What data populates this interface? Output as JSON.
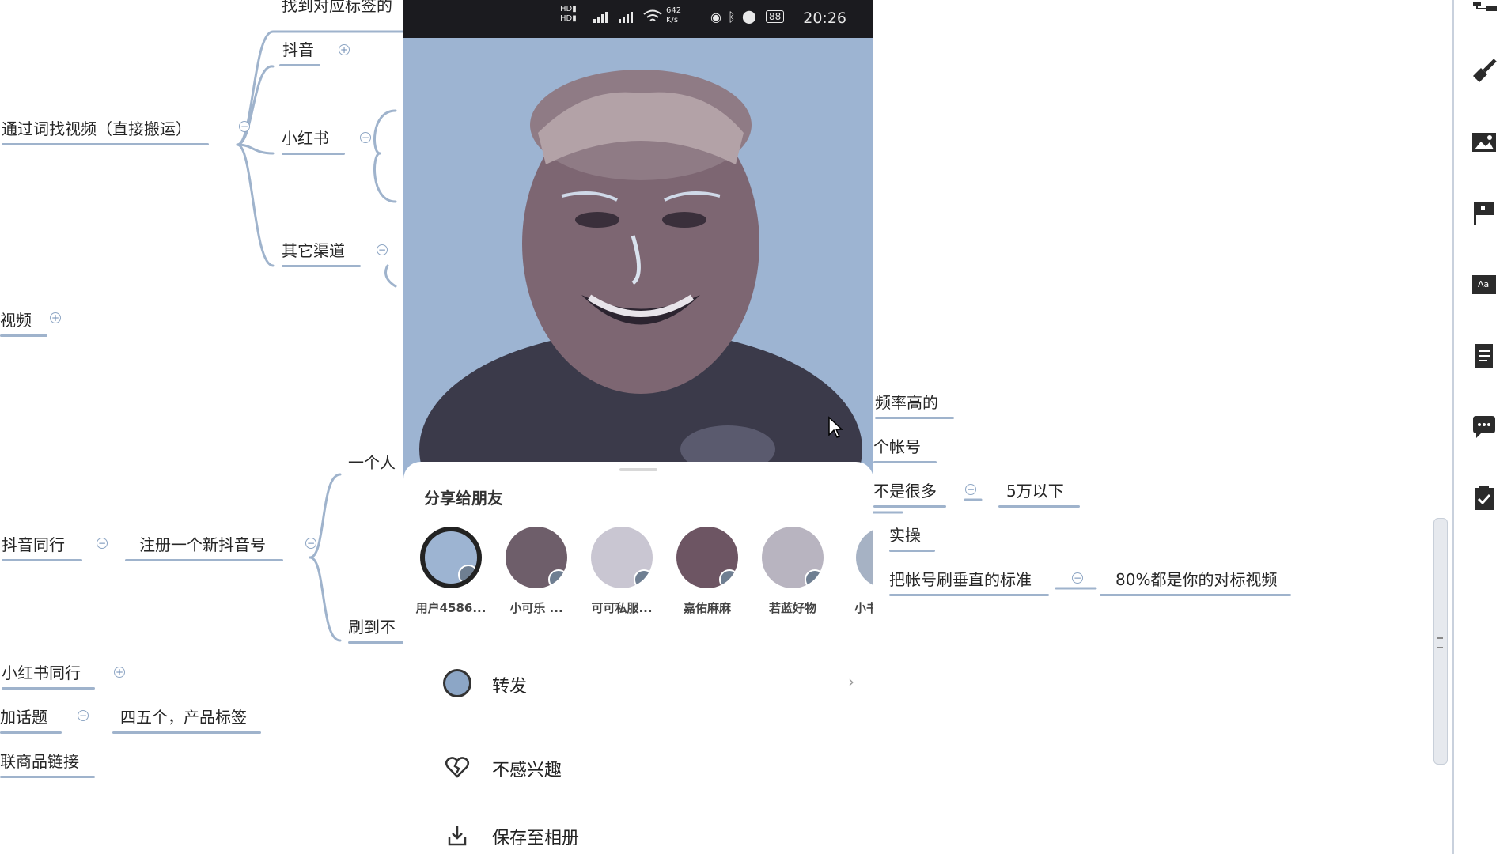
{
  "mindmap": {
    "top_cut": "找到对应标签的",
    "douyin": "抖音",
    "via_keyword": "通过词找视频（直接搬运）",
    "xiaohongshu": "小红书",
    "other_channels": "其它渠道",
    "video": "视频",
    "one_person": "一个人",
    "douyin_peer": "抖音同行",
    "register_new": "注册一个新抖音号",
    "brush_to": "刷到不",
    "xhs_peer": "小红书同行",
    "add_topic": "加话题",
    "four_five": "四五个，产品标签",
    "link_goods": "联商品链接",
    "freq_high": "频率高的",
    "one_account": "个帐号",
    "not_many": "不是很多",
    "under_50k": "5万以下",
    "practice": "实操",
    "standard": "把帐号刷垂直的标准",
    "eighty_pct": "80%都是你的对标视频"
  },
  "status_bar": {
    "net_speed": "642\nK/s",
    "battery": "88",
    "time": "20:26"
  },
  "share_sheet": {
    "title": "分享给朋友",
    "friends": [
      {
        "name": "用户4586..."
      },
      {
        "name": "小可乐 ..."
      },
      {
        "name": "可可私服..."
      },
      {
        "name": "嘉佑麻麻"
      },
      {
        "name": "若蓝好物"
      },
      {
        "name": "小书"
      }
    ],
    "actions": {
      "forward": "转发",
      "not_interested": "不感兴趣",
      "save_album": "保存至相册"
    }
  },
  "colors": {
    "branch_line": "#9fb3cc",
    "toggle": "#8ea6c4",
    "photo_bg": "#9db4d2"
  }
}
